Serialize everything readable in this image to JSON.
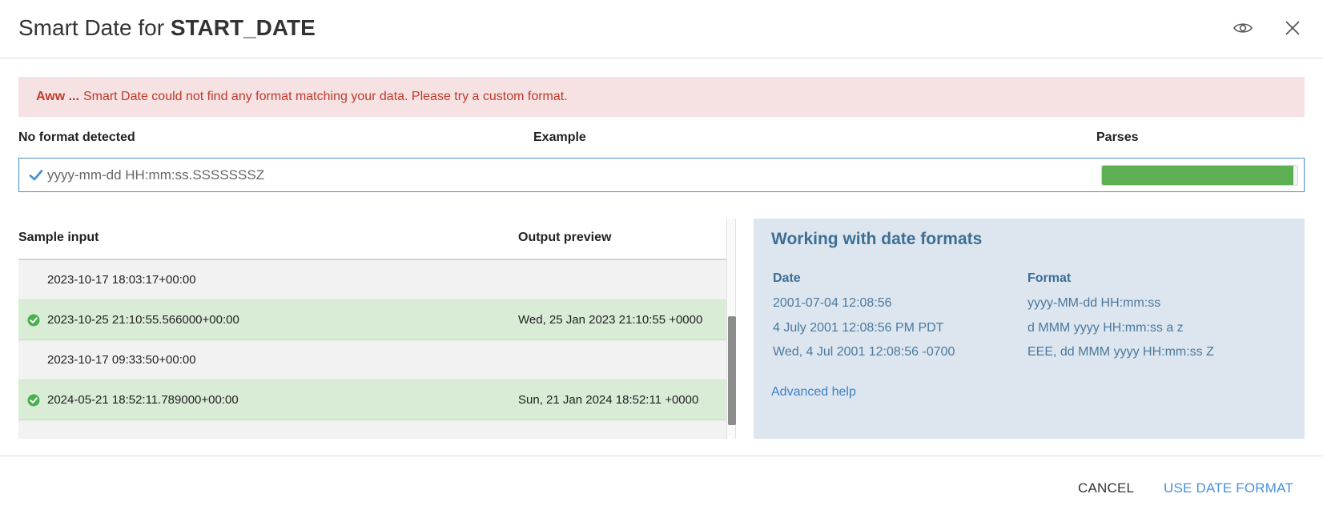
{
  "header": {
    "title_prefix": "Smart Date for",
    "title_column": "START_DATE",
    "icons": [
      "eye-icon",
      "close-icon"
    ]
  },
  "alert": {
    "strong": "Aww ...",
    "message": "Smart Date could not find any format matching your data. Please try a custom format."
  },
  "formats": {
    "col_format": "No format detected",
    "col_example": "Example",
    "col_parses": "Parses",
    "rows": [
      {
        "pattern": "yyyy-mm-dd HH:mm:ss.SSSSSSSZ",
        "example": "",
        "parse_fraction": 0.98,
        "selected": true
      }
    ]
  },
  "samples": {
    "col_input": "Sample input",
    "col_output": "Output preview",
    "rows": [
      {
        "input": "2023-10-17 18:03:17+00:00",
        "output": "",
        "ok": false
      },
      {
        "input": "2023-10-25 21:10:55.566000+00:00",
        "output": "Wed, 25 Jan 2023 21:10:55 +0000",
        "ok": true
      },
      {
        "input": "2023-10-17 09:33:50+00:00",
        "output": "",
        "ok": false
      },
      {
        "input": "2024-05-21 18:52:11.789000+00:00",
        "output": "Sun, 21 Jan 2024 18:52:11 +0000",
        "ok": true
      }
    ]
  },
  "help": {
    "title": "Working with date formats",
    "col_date": "Date",
    "col_format": "Format",
    "rows": [
      {
        "date": "2001-07-04 12:08:56",
        "format": "yyyy-MM-dd HH:mm:ss"
      },
      {
        "date": "4 July 2001 12:08:56 PM PDT",
        "format": "d MMM yyyy HH:mm:ss a z"
      },
      {
        "date": "Wed, 4 Jul 2001 12:08:56 -0700",
        "format": "EEE, dd MMM yyyy HH:mm:ss Z"
      }
    ],
    "link": "Advanced help"
  },
  "footer": {
    "cancel": "CANCEL",
    "use": "USE DATE FORMAT"
  },
  "colors": {
    "accent": "#4a90d9",
    "alert_bg": "#f6e2e2",
    "alert_text": "#c0392b",
    "ok_row": "#d9ecd6",
    "parse_fill": "#5caf52",
    "help_bg": "#dde6ee"
  }
}
